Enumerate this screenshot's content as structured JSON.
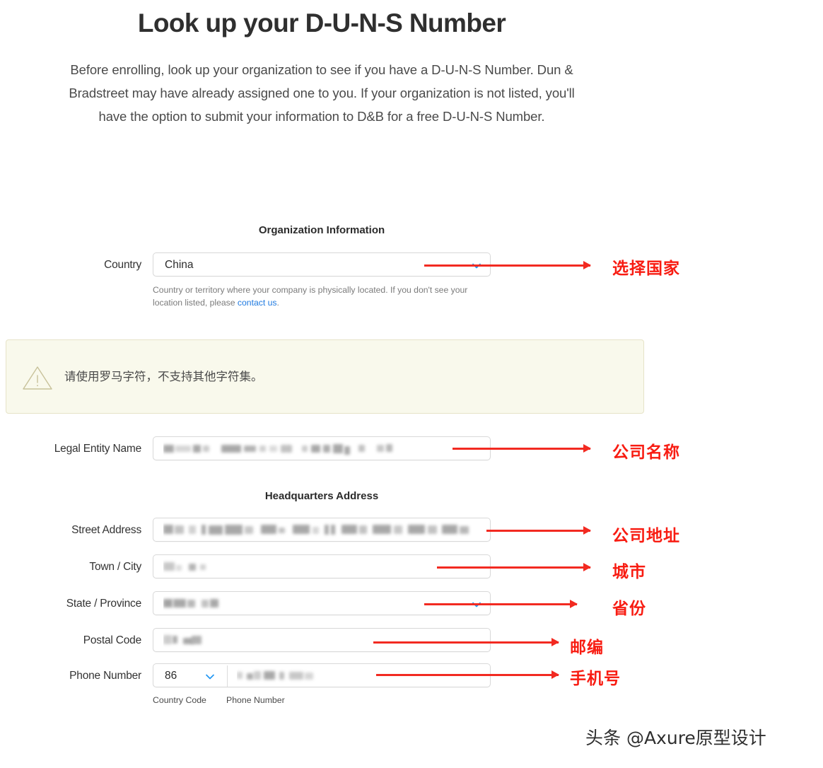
{
  "header": {
    "title": "Look up your D-U-N-S Number",
    "paragraph": "Before enrolling, look up your organization to see if you have a D-U-N-S Number. Dun & Bradstreet may have already assigned one to you. If your organization is not listed, you'll have the option to submit your information to D&B for a free D-U-N-S Number."
  },
  "sections": {
    "organization": "Organization Information",
    "headquarters": "Headquarters Address"
  },
  "country": {
    "label": "Country",
    "value": "China",
    "chevron_icon": "chevron-down-icon",
    "help_text_before": "Country or territory where your company is physically located. If you don't see your location listed, please ",
    "help_link": "contact us",
    "help_text_after": "."
  },
  "warning": {
    "icon": "warning-triangle-icon",
    "text": "请使用罗马字符，不支持其他字符集。",
    "background_color": "#f9f9ec",
    "border_color": "#e6e3c8",
    "icon_color": "#c8c29a"
  },
  "fields": {
    "legal_entity_name": {
      "label": "Legal Entity Name",
      "value": "",
      "redacted": true
    },
    "street_address": {
      "label": "Street Address",
      "value": "",
      "redacted": true
    },
    "town_city": {
      "label": "Town / City",
      "value": "",
      "redacted": true
    },
    "state_province": {
      "label": "State / Province",
      "value": "",
      "redacted": true,
      "chevron_icon": "chevron-down-icon"
    },
    "postal_code": {
      "label": "Postal Code",
      "value": "",
      "redacted": true
    },
    "phone": {
      "label": "Phone Number",
      "country_code_value": "86",
      "chevron_icon": "chevron-down-icon",
      "number_value": "",
      "redacted": true,
      "sub_label_country_code": "Country Code",
      "sub_label_phone_number": "Phone Number"
    }
  },
  "annotations": {
    "color": "#f81c12",
    "items": [
      {
        "text": "选择国家"
      },
      {
        "text": "公司名称"
      },
      {
        "text": "公司地址"
      },
      {
        "text": "城市"
      },
      {
        "text": "省份"
      },
      {
        "text": "邮编"
      },
      {
        "text": "手机号"
      }
    ]
  },
  "watermark": {
    "text": "头条 @Axure原型设计"
  }
}
